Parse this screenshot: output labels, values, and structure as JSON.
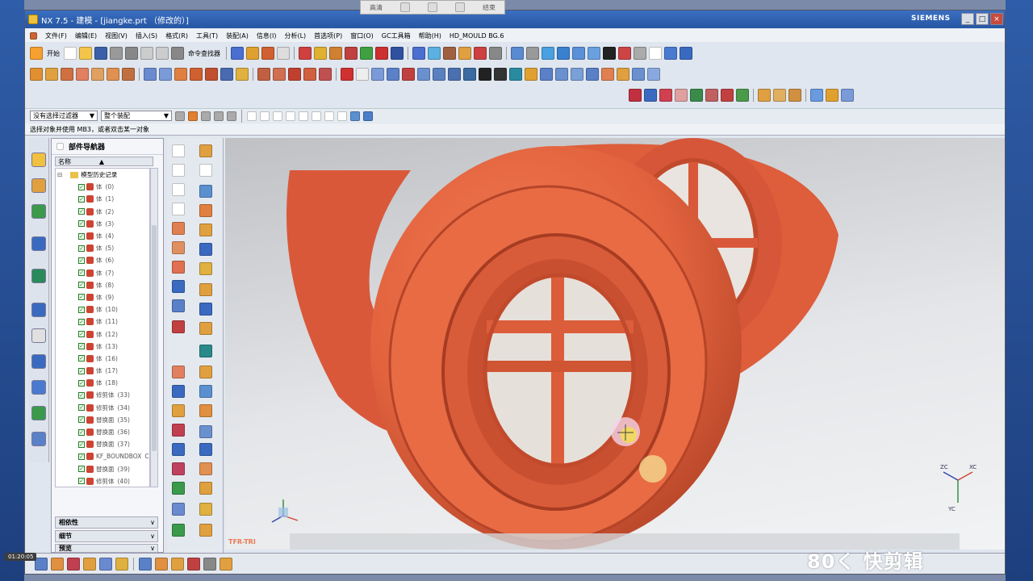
{
  "window": {
    "title": "NX 7.5 - 建模 - [jiangke.prt （修改的）]",
    "brand": "SIEMENS",
    "minimize": "_",
    "maximize": "□",
    "close": "×"
  },
  "overlay": {
    "btn1": "高清",
    "btn2": "结束"
  },
  "menu": {
    "items": [
      "文件(F)",
      "编辑(E)",
      "视图(V)",
      "插入(S)",
      "格式(R)",
      "工具(T)",
      "装配(A)",
      "信息(I)",
      "分析(L)",
      "首选项(P)",
      "窗口(O)",
      "GC工具箱",
      "帮助(H)",
      "HD_MOULD BG.6"
    ]
  },
  "toolbar": {
    "start_label": "开始",
    "command_finder_label": "命令查找器"
  },
  "selection": {
    "filter": "没有选择过滤器",
    "scope": "整个装配"
  },
  "status": {
    "prompt": "选择对象并使用 MB3，或者双击某一对象"
  },
  "navigator": {
    "title": "部件导航器",
    "column_name": "名称",
    "root_label": "模型历史记录",
    "rows": [
      {
        "name": "体",
        "num": "(0)"
      },
      {
        "name": "体",
        "num": "(1)"
      },
      {
        "name": "体",
        "num": "(2)"
      },
      {
        "name": "体",
        "num": "(3)"
      },
      {
        "name": "体",
        "num": "(4)"
      },
      {
        "name": "体",
        "num": "(5)"
      },
      {
        "name": "体",
        "num": "(6)"
      },
      {
        "name": "体",
        "num": "(7)"
      },
      {
        "name": "体",
        "num": "(8)"
      },
      {
        "name": "体",
        "num": "(9)"
      },
      {
        "name": "体",
        "num": "(10)"
      },
      {
        "name": "体",
        "num": "(11)"
      },
      {
        "name": "体",
        "num": "(12)"
      },
      {
        "name": "体",
        "num": "(13)"
      },
      {
        "name": "体",
        "num": "(16)"
      },
      {
        "name": "体",
        "num": "(17)"
      },
      {
        "name": "体",
        "num": "(18)"
      },
      {
        "name": "修剪体",
        "num": "(33)"
      },
      {
        "name": "修剪体",
        "num": "(34)"
      },
      {
        "name": "替换面",
        "num": "(35)"
      },
      {
        "name": "替换面",
        "num": "(36)"
      },
      {
        "name": "替换面",
        "num": "(37)"
      },
      {
        "name": "KF_BOUNDBOX",
        "num": "C"
      },
      {
        "name": "替换面",
        "num": "(39)"
      },
      {
        "name": "修剪体",
        "num": "(40)"
      }
    ],
    "panels": [
      "相依性",
      "细节",
      "预览"
    ]
  },
  "viewport": {
    "label": "TFR-TRI",
    "axes": {
      "zc": "ZC",
      "xc": "XC",
      "yc": "YC"
    },
    "model_color": "#e2633e"
  },
  "clock": "01:20:05",
  "watermark": "80く 快剪辑"
}
